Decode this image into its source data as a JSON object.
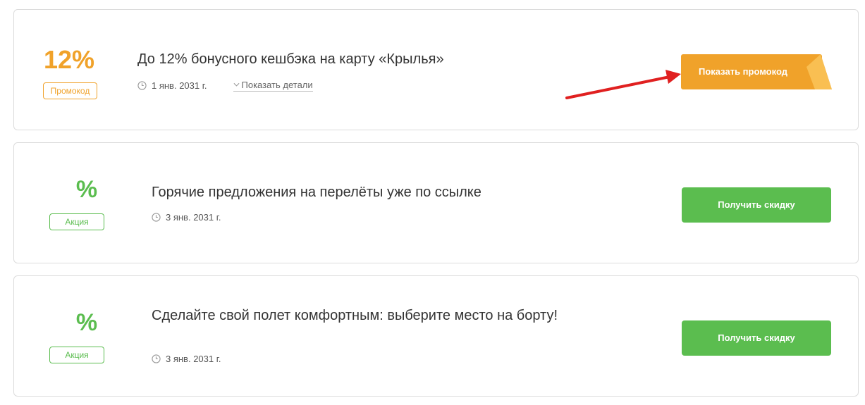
{
  "offers": [
    {
      "value": "12%",
      "badge": "Промокод",
      "title": "До 12% бонусного кешбэка на карту «Крылья»",
      "date": "1 янв. 2031 г.",
      "details_label": "Показать детали",
      "button_label": "Показать промокод",
      "accent_color": "#f0a22a"
    },
    {
      "value": "%",
      "badge": "Акция",
      "title": "Горячие предложения на перелёты уже по ссылке",
      "date": "3 янв. 2031 г.",
      "button_label": "Получить скидку",
      "accent_color": "#5bbd4f"
    },
    {
      "value": "%",
      "badge": "Акция",
      "title": "Сделайте свой полет комфортным: выберите место на борту!",
      "date": "3 янв. 2031 г.",
      "button_label": "Получить скидку",
      "accent_color": "#5bbd4f"
    }
  ],
  "icons": {
    "clock": "clock-icon",
    "chevron": "chevron-down-icon",
    "annotation": "red-arrow-annotation"
  },
  "colors": {
    "promo_orange": "#f0a22a",
    "action_green": "#5bbd4f",
    "annotation_red": "#e02020"
  }
}
